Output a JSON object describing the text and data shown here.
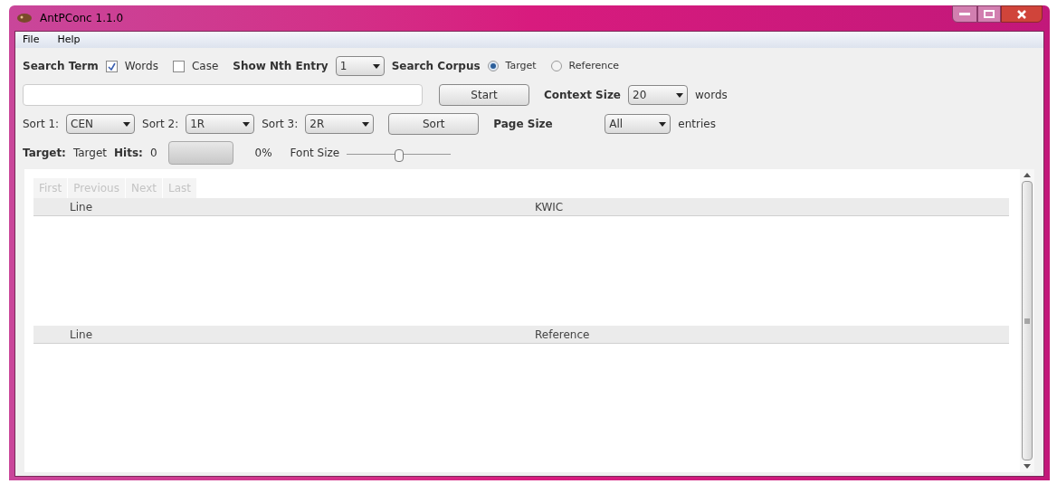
{
  "window": {
    "title": "AntPConc 1.1.0"
  },
  "menu": [
    "File",
    "Help"
  ],
  "search_row": {
    "label": "Search Term",
    "options": [
      {
        "label": "Words",
        "checked": true
      },
      {
        "label": "Case",
        "checked": false
      }
    ],
    "nth_label": "Show Nth Entry",
    "nth_value": "1",
    "corpus_label": "Search Corpus",
    "corpus": [
      {
        "label": "Target",
        "selected": true
      },
      {
        "label": "Reference",
        "selected": false
      }
    ]
  },
  "query_row": {
    "start": "Start",
    "context_label": "Context Size",
    "context_value": "20",
    "context_unit": "words"
  },
  "sort_row": {
    "sorts": [
      {
        "label": "Sort 1:",
        "value": "CEN"
      },
      {
        "label": "Sort 2:",
        "value": "1R"
      },
      {
        "label": "Sort 3:",
        "value": "2R"
      }
    ],
    "sort_button": "Sort",
    "page_label": "Page Size",
    "page_value": "All",
    "page_unit": "entries"
  },
  "status_row": {
    "target_label": "Target:",
    "target_value": "Target",
    "hits_label": "Hits:",
    "hits_value": "0",
    "progress": {
      "level": 0
    },
    "percent": "0%",
    "font_label": "Font Size",
    "font_slider": {
      "level": 0.5
    }
  },
  "pager": [
    {
      "label": "First",
      "disabled": true
    },
    {
      "label": "Previous",
      "disabled": true
    },
    {
      "label": "Next",
      "disabled": true
    },
    {
      "label": "Last",
      "disabled": true
    }
  ],
  "tables": [
    {
      "columns": [
        "Line",
        "KWIC"
      ]
    },
    {
      "columns": [
        "Line",
        "Reference"
      ]
    }
  ]
}
